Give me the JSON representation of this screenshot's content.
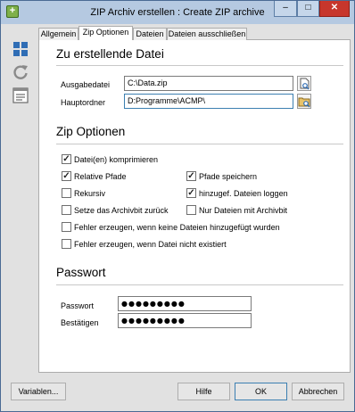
{
  "window": {
    "title": "ZIP Archiv erstellen : Create ZIP archive"
  },
  "titlebar": {
    "min_glyph": "–",
    "max_glyph": "□",
    "close_glyph": "✕",
    "app_icon_glyph": "+"
  },
  "tabs": [
    {
      "label": "Allgemein",
      "active": false
    },
    {
      "label": "Zip Optionen",
      "active": true
    },
    {
      "label": "Dateien",
      "active": false
    },
    {
      "label": "Dateien ausschließen",
      "active": false
    }
  ],
  "file_section": {
    "title": "Zu erstellende Datei",
    "output_label": "Ausgabedatei",
    "output_value": "C:\\Data.zip",
    "root_label": "Hauptordner",
    "root_value": "D:Programme\\ACMP\\"
  },
  "zip_options": {
    "title": "Zip Optionen",
    "options": {
      "compress": {
        "label": "Datei(en) komprimieren",
        "checked": true
      },
      "relative_paths": {
        "label": "Relative Pfade",
        "checked": true
      },
      "save_paths": {
        "label": "Pfade speichern",
        "checked": true
      },
      "recursive": {
        "label": "Rekursiv",
        "checked": false
      },
      "log_added": {
        "label": "hinzugef. Dateien loggen",
        "checked": true
      },
      "reset_archive_bit": {
        "label": "Setze das Archivbit zurück",
        "checked": false
      },
      "only_archive_bit": {
        "label": "Nur Dateien mit Archivbit",
        "checked": false
      },
      "error_no_files": {
        "label": "Fehler erzeugen, wenn keine Dateien hinzugefügt wurden",
        "checked": false
      },
      "error_missing": {
        "label": "Fehler erzeugen, wenn Datei nicht existiert",
        "checked": false
      }
    },
    "check_glyph": "✓"
  },
  "password_section": {
    "title": "Passwort",
    "password_label": "Passwort",
    "password_value": "●●●●●●●●●",
    "confirm_label": "Bestätigen",
    "confirm_value": "●●●●●●●●●"
  },
  "buttons": {
    "variables": "Variablen...",
    "help": "Hilfe",
    "ok": "OK",
    "cancel": "Abbrechen"
  },
  "icons": {
    "app": "zip-app-icon",
    "sidebar": [
      "grid-icon",
      "refresh-icon",
      "list-icon"
    ],
    "browse": [
      "file-browse-icon",
      "folder-browse-icon"
    ]
  }
}
